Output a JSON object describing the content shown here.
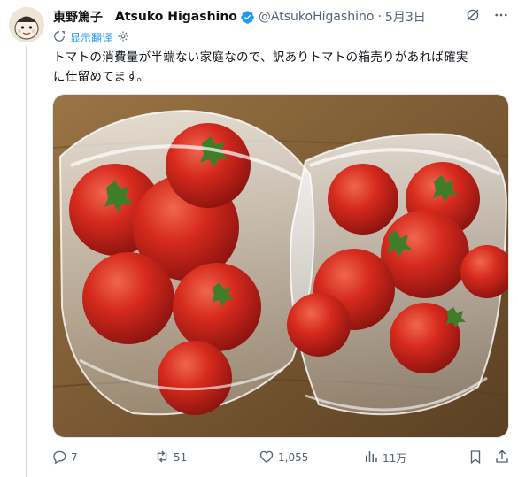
{
  "tweet": {
    "author_name": "東野篤子",
    "display_name": "Atsuko Higashino",
    "handle": "@AtsukoHigashino",
    "separator": "·",
    "date": "5月3日",
    "translate_label": "显示翻译",
    "text_line1": "トマトの消費量が半端ない家庭なので、訳ありトマトの箱売りがあれば確実",
    "text_line2": "に仕留めてます。",
    "image_alt": "tomatoes in plastic bags"
  },
  "actions": {
    "replies": "7",
    "reposts": "51",
    "likes": "1,055",
    "views": "11万"
  },
  "colors": {
    "link": "#1d9bf0",
    "verified": "#1d9bf0",
    "muted": "#536471",
    "tomato": "#d7261c",
    "table": "#7a5a34"
  }
}
